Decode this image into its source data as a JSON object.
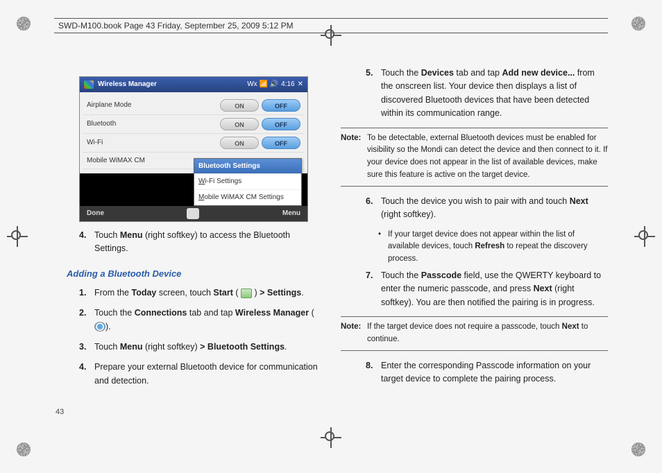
{
  "header": "SWD-M100.book  Page 43  Friday, September 25, 2009  5:12 PM",
  "page_number": "43",
  "screenshot": {
    "title": "Wireless Manager",
    "time": "4:16",
    "status_icons": "Wx 📶 🔊",
    "rows": [
      {
        "label": "Airplane Mode",
        "on": "ON",
        "off": "OFF"
      },
      {
        "label": "Bluetooth",
        "on": "ON",
        "off": "OFF"
      },
      {
        "label": "Wi-Fi",
        "on": "ON",
        "off": "OFF"
      },
      {
        "label": "Mobile WiMAX CM",
        "on": "",
        "off": ""
      }
    ],
    "menu_popup": {
      "header": "Bluetooth Settings",
      "item1_u": "W",
      "item1_rest": "i-Fi Settings",
      "item2_u": "M",
      "item2_rest": "obile WiMAX CM Settings"
    },
    "footer": {
      "done": "Done",
      "menu": "Menu"
    }
  },
  "left_step4_a": "Touch ",
  "left_step4_b": "Menu",
  "left_step4_c": " (right softkey) to access the Bluetooth Settings.",
  "heading": "Adding a Bluetooth Device",
  "l1": {
    "num": "1.",
    "a": "From the ",
    "b": "Today",
    "c": " screen, touch ",
    "d": "Start",
    "e": " ( ",
    "f": " ) ",
    "g": "> Settings",
    "h": "."
  },
  "l2": {
    "num": "2.",
    "a": "Touch the ",
    "b": "Connections",
    "c": " tab and tap ",
    "d": "Wireless Manager",
    "e": " (",
    "f": ")."
  },
  "l3": {
    "num": "3.",
    "a": "Touch ",
    "b": "Menu",
    "c": " (right softkey) ",
    "d": "> Bluetooth Settings",
    "e": "."
  },
  "l4": {
    "num": "4.",
    "a": "Prepare your external Bluetooth device for communication and detection."
  },
  "r5": {
    "num": "5.",
    "a": "Touch the ",
    "b": "Devices",
    "c": " tab and tap ",
    "d": "Add new device...",
    "e": " from the onscreen list. Your device then displays a list of discovered Bluetooth devices that have been detected within its communication range."
  },
  "note1": {
    "label": "Note:",
    "text": "To be detectable, external Bluetooth devices must be enabled for visibility so the Mondi can detect the device and then connect to it. If your device does not appear in the list of available devices, make sure this feature is active on the target device."
  },
  "r6": {
    "num": "6.",
    "a": "Touch the device you wish to pair with and touch ",
    "b": "Next",
    "c": " (right softkey)."
  },
  "r6_bullet": {
    "a": "If your target device does not appear within the list of available devices, touch ",
    "b": "Refresh",
    "c": " to repeat the discovery process."
  },
  "r7": {
    "num": "7.",
    "a": "Touch the ",
    "b": "Passcode",
    "c": " field, use the QWERTY keyboard to enter the numeric passcode, and press ",
    "d": "Next",
    "e": " (right softkey). You are then notified the pairing is in progress."
  },
  "note2": {
    "label": "Note:",
    "a": "If the target device does not require a passcode, touch ",
    "b": "Next",
    "c": " to continue."
  },
  "r8": {
    "num": "8.",
    "a": "Enter the corresponding Passcode information on your target device to complete the pairing process."
  }
}
